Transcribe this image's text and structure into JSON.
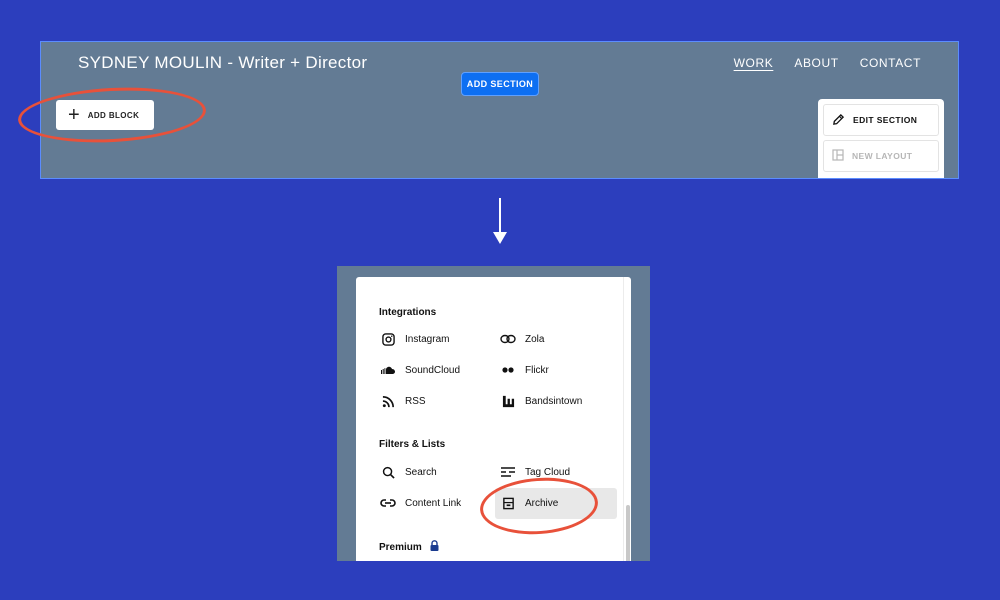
{
  "top": {
    "site_title": "SYDNEY MOULIN - Writer + Director",
    "nav": [
      {
        "label": "WORK",
        "active": true
      },
      {
        "label": "ABOUT",
        "active": false
      },
      {
        "label": "CONTACT",
        "active": false
      }
    ],
    "add_section_label": "ADD SECTION",
    "add_block_label": "ADD BLOCK",
    "section_menu": {
      "edit_section": "EDIT SECTION",
      "new_layout": "NEW LAYOUT"
    }
  },
  "block_menu": {
    "integrations_title": "Integrations",
    "integrations": {
      "instagram": "Instagram",
      "zola": "Zola",
      "soundcloud": "SoundCloud",
      "flickr": "Flickr",
      "rss": "RSS",
      "bandsintown": "Bandsintown"
    },
    "filters_title": "Filters & Lists",
    "filters": {
      "search": "Search",
      "tag_cloud": "Tag Cloud",
      "content_link": "Content Link",
      "archive": "Archive"
    },
    "premium_title": "Premium"
  },
  "colors": {
    "background": "#2c3ebd",
    "panel": "#637b94",
    "accent_blue": "#0d6ff2",
    "highlight_red": "#e8513a"
  }
}
